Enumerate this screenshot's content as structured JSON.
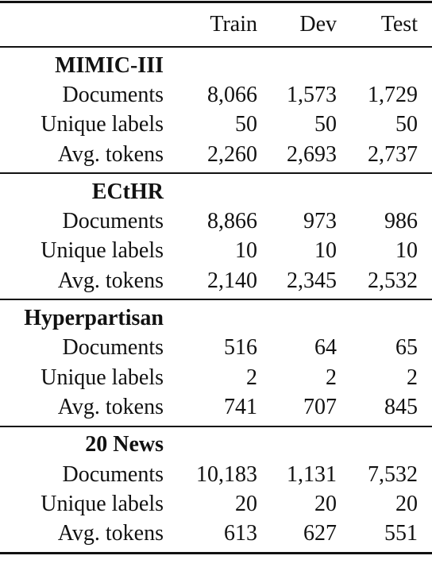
{
  "table": {
    "columns": [
      "",
      "Train",
      "Dev",
      "Test"
    ],
    "groups": [
      {
        "name": "MIMIC-III",
        "rows": [
          {
            "label": "Documents",
            "train": "8,066",
            "dev": "1,573",
            "test": "1,729"
          },
          {
            "label": "Unique labels",
            "train": "50",
            "dev": "50",
            "test": "50"
          },
          {
            "label": "Avg. tokens",
            "train": "2,260",
            "dev": "2,693",
            "test": "2,737"
          }
        ]
      },
      {
        "name": "ECtHR",
        "rows": [
          {
            "label": "Documents",
            "train": "8,866",
            "dev": "973",
            "test": "986"
          },
          {
            "label": "Unique labels",
            "train": "10",
            "dev": "10",
            "test": "10"
          },
          {
            "label": "Avg. tokens",
            "train": "2,140",
            "dev": "2,345",
            "test": "2,532"
          }
        ]
      },
      {
        "name": "Hyperpartisan",
        "rows": [
          {
            "label": "Documents",
            "train": "516",
            "dev": "64",
            "test": "65"
          },
          {
            "label": "Unique labels",
            "train": "2",
            "dev": "2",
            "test": "2"
          },
          {
            "label": "Avg. tokens",
            "train": "741",
            "dev": "707",
            "test": "845"
          }
        ]
      },
      {
        "name": "20 News",
        "rows": [
          {
            "label": "Documents",
            "train": "10,183",
            "dev": "1,131",
            "test": "7,532"
          },
          {
            "label": "Unique labels",
            "train": "20",
            "dev": "20",
            "test": "20"
          },
          {
            "label": "Avg. tokens",
            "train": "613",
            "dev": "627",
            "test": "551"
          }
        ]
      }
    ]
  }
}
